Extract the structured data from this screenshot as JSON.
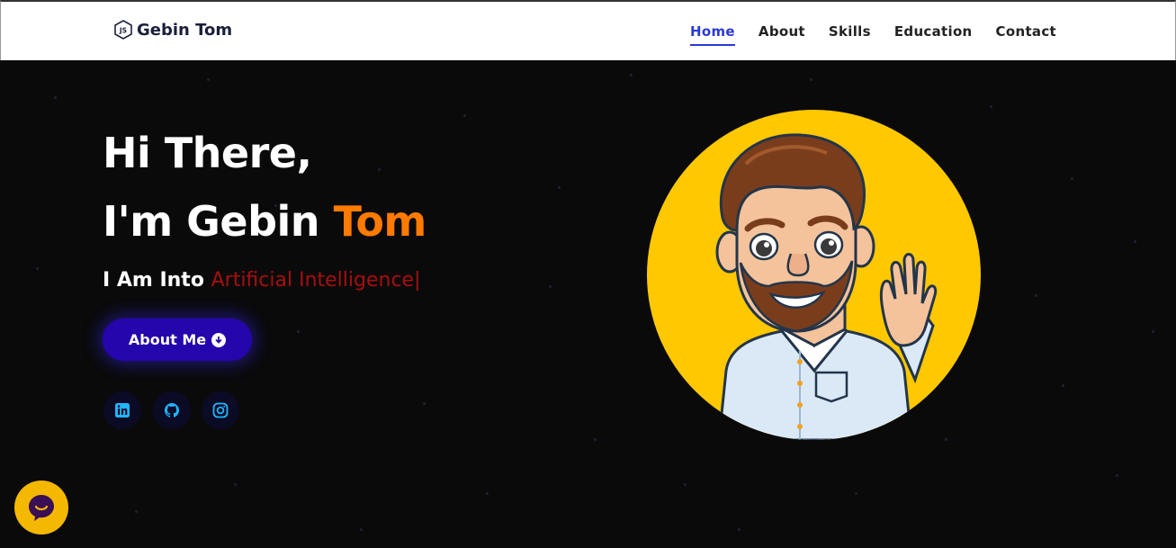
{
  "brand": {
    "icon": "js-icon",
    "name": "Gebin Tom"
  },
  "nav": [
    {
      "label": "Home",
      "active": true
    },
    {
      "label": "About",
      "active": false
    },
    {
      "label": "Skills",
      "active": false
    },
    {
      "label": "Education",
      "active": false
    },
    {
      "label": "Contact",
      "active": false
    }
  ],
  "hero": {
    "greeting_line1": "Hi There,",
    "greeting_line2_prefix": "I'm Gebin ",
    "greeting_line2_accent": "Tom",
    "into_prefix": "I Am Into ",
    "typed_text": "Artificial Intelligence|",
    "about_button_label": "About Me",
    "about_button_icon": "arrow-down-circle-icon",
    "socials": [
      {
        "name": "linkedin",
        "icon": "linkedin-icon"
      },
      {
        "name": "github",
        "icon": "github-icon"
      },
      {
        "name": "instagram",
        "icon": "instagram-icon"
      }
    ],
    "avatar": "cartoon-avatar-waving"
  },
  "chat_widget": {
    "icon": "chat-bubble-icon"
  },
  "colors": {
    "accent_orange": "#ff7a00",
    "typed_red": "#a70f0f",
    "button_blue": "#2506ad",
    "nav_active": "#2a3ad6",
    "avatar_bg": "#ffc800",
    "social_icon": "#1fb6ff"
  }
}
